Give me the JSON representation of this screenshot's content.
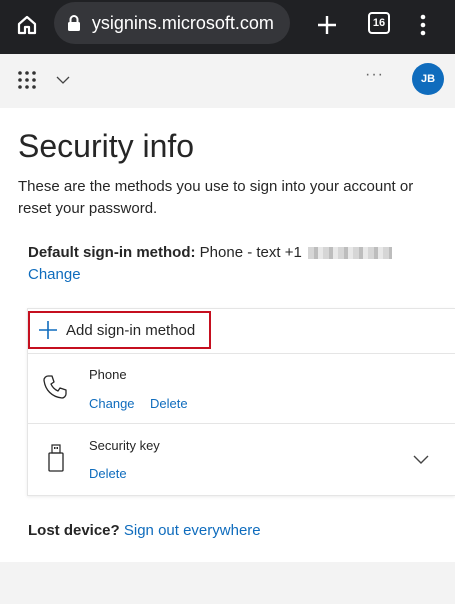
{
  "browser": {
    "url": "ysignins.microsoft.com",
    "tab_count": "16"
  },
  "header": {
    "more_label": "···",
    "avatar_initials": "JB"
  },
  "page": {
    "title": "Security info",
    "description": "These are the methods you use to sign into your account or reset your password.",
    "default_label": "Default sign-in method:",
    "default_value": "Phone - text +1",
    "default_change": "Change",
    "add_method_label": "Add sign-in method",
    "methods": [
      {
        "name": "Phone",
        "icon": "phone-icon",
        "actions": [
          "Change",
          "Delete"
        ]
      },
      {
        "name": "Security key",
        "icon": "usb-key-icon",
        "actions": [
          "Delete"
        ]
      }
    ],
    "lost_device_label": "Lost device?",
    "sign_out_everywhere": "Sign out everywhere"
  },
  "colors": {
    "accent": "#0f6cbd",
    "highlight_border": "#c50f1f",
    "browser_bar": "#202124"
  }
}
